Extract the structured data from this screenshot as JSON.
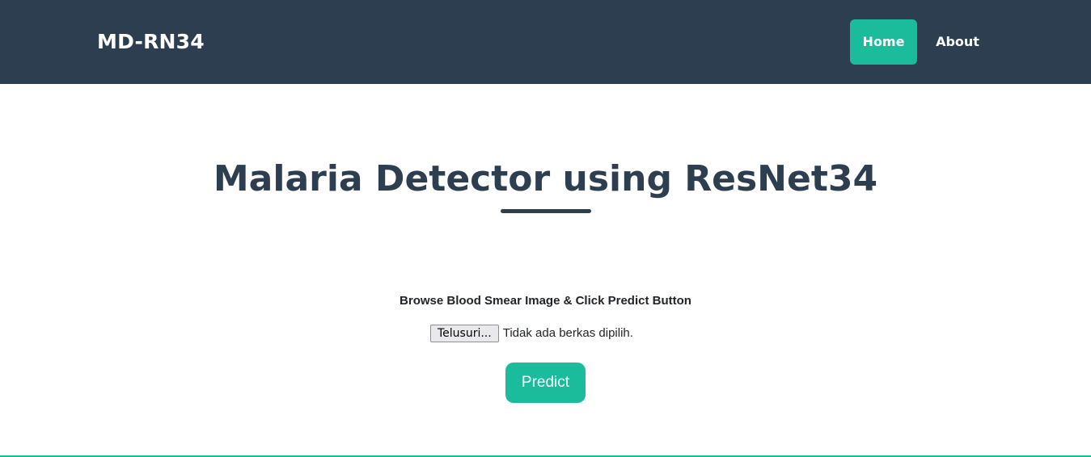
{
  "navbar": {
    "brand": "MD-RN34",
    "items": [
      {
        "label": "Home",
        "active": true
      },
      {
        "label": "About",
        "active": false
      }
    ]
  },
  "main": {
    "title": "Malaria Detector using ResNet34",
    "instruction": "Browse Blood Smear Image & Click Predict Button",
    "file_input": {
      "button_label": "Telusuri...",
      "status": "Tidak ada berkas dipilih."
    },
    "predict_label": "Predict"
  },
  "colors": {
    "navbar_bg": "#2c3e50",
    "accent": "#1abc9c",
    "title": "#2c3e50"
  }
}
